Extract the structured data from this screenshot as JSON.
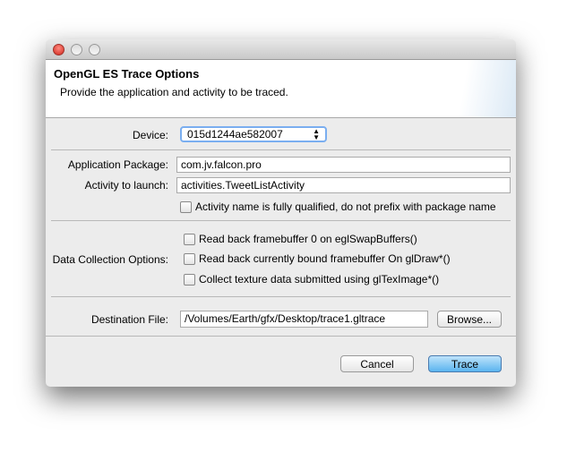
{
  "window": {
    "title_controls": [
      "close",
      "minimize",
      "zoom"
    ]
  },
  "header": {
    "title": "OpenGL ES Trace Options",
    "subtitle": "Provide the application and activity to be traced."
  },
  "device": {
    "label": "Device:",
    "value": "015d1244ae582007"
  },
  "app_package": {
    "label": "Application Package:",
    "value": "com.jv.falcon.pro"
  },
  "activity": {
    "label": "Activity to launch:",
    "value": "activities.TweetListActivity"
  },
  "fully_qualified": {
    "label": "Activity name is fully qualified, do not prefix with package name",
    "checked": false
  },
  "data_collection": {
    "label": "Data Collection Options:",
    "options": [
      {
        "label": "Read back framebuffer 0 on eglSwapBuffers()",
        "checked": false
      },
      {
        "label": "Read back currently bound framebuffer On glDraw*()",
        "checked": false
      },
      {
        "label": "Collect texture data submitted using glTexImage*()",
        "checked": false
      }
    ]
  },
  "destination": {
    "label": "Destination File:",
    "value": "/Volumes/Earth/gfx/Desktop/trace1.gltrace",
    "browse": "Browse..."
  },
  "buttons": {
    "cancel": "Cancel",
    "trace": "Trace"
  }
}
